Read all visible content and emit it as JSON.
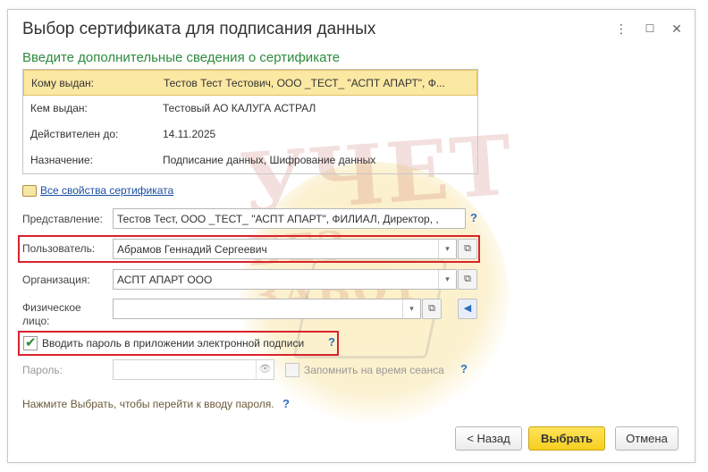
{
  "window": {
    "title": "Выбор сертификата для подписания данных",
    "subtitle": "Введите дополнительные сведения о сертификате"
  },
  "cert_info": [
    {
      "label": "Кому выдан:",
      "value": "Тестов Тест Тестович, ООО _ТЕСТ_ \"АСПТ АПАРТ\", Ф..."
    },
    {
      "label": "Кем выдан:",
      "value": "Тестовый АО КАЛУГА АСТРАЛ"
    },
    {
      "label": "Действителен до:",
      "value": "14.11.2025"
    },
    {
      "label": "Назначение:",
      "value": "Подписание данных, Шифрование данных"
    }
  ],
  "links": {
    "all_properties": "Все свойства сертификата"
  },
  "form": {
    "representation": {
      "label": "Представление:",
      "value": "Тестов Тест, ООО _ТЕСТ_ \"АСПТ АПАРТ\", ФИЛИАЛ, Директор, ,"
    },
    "user": {
      "label": "Пользователь:",
      "value": "Абрамов Геннадий Сергеевич"
    },
    "organization": {
      "label": "Организация:",
      "value": "АСПТ АПАРТ ООО"
    },
    "person": {
      "label_line1": "Физическое",
      "label_line2": "лицо:",
      "value": ""
    },
    "enter_password_in_app": {
      "label": "Вводить пароль в приложении электронной подписи",
      "checked": true
    },
    "password": {
      "label": "Пароль:",
      "value": ""
    },
    "remember": {
      "label": "Запомнить на время сеанса",
      "checked": false
    }
  },
  "hint": "Нажмите Выбрать, чтобы перейти к вводу пароля.",
  "buttons": {
    "back": "< Назад",
    "select": "Выбрать",
    "cancel": "Отмена"
  },
  "glyphs": {
    "question": "?",
    "dropdown": "▾",
    "menu": "⋮",
    "restore": "☐",
    "close": "✕",
    "eye": "👁",
    "open": "⧉",
    "arrow_left": "◀"
  },
  "watermark": {
    "line1": "УЧЕТ",
    "line2": "БЕЗ ЗАБОТ"
  },
  "colors": {
    "accent_green": "#2e8b3e",
    "selected_row": "#fbe8a3",
    "primary_button": "#f6cf1f",
    "highlight_red": "#d9232d",
    "link_blue": "#1a4fa0"
  }
}
